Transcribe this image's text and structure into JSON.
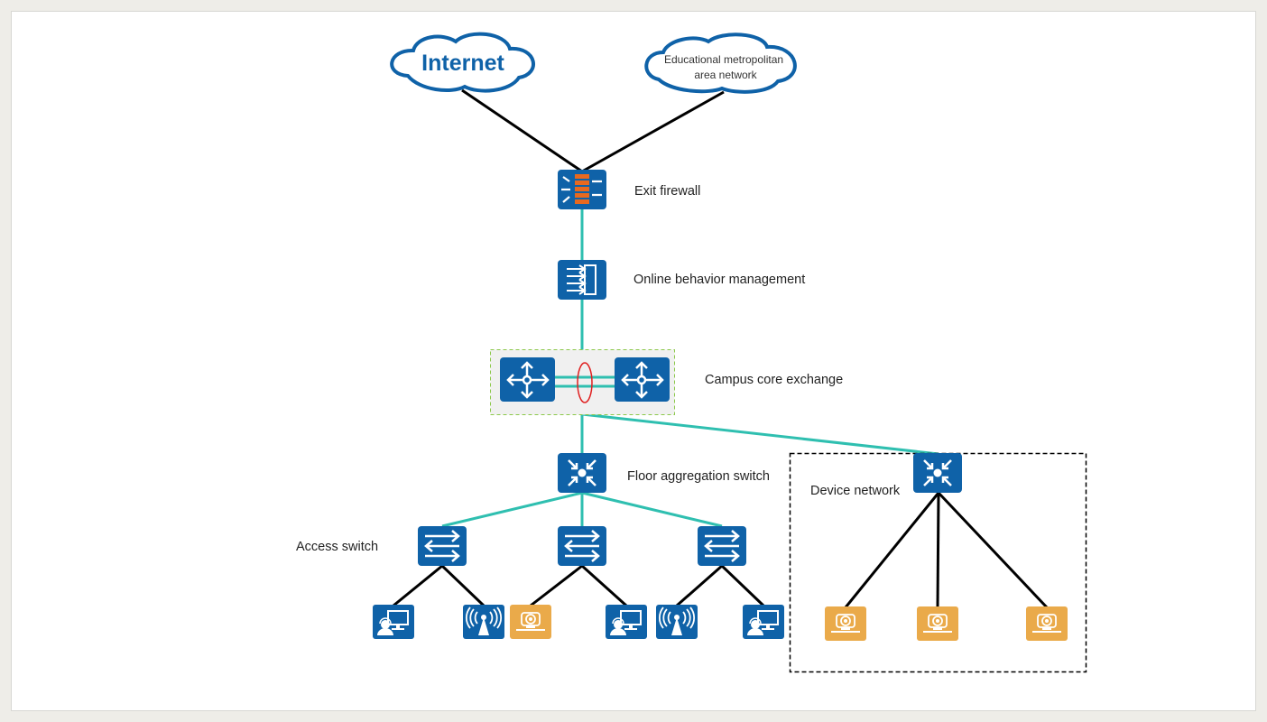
{
  "clouds": {
    "internet": "Internet",
    "education_line1": "Educational metropolitan",
    "education_line2": "area network"
  },
  "labels": {
    "exit_firewall": "Exit firewall",
    "online_behavior": "Online behavior management",
    "core": "Campus core exchange",
    "floor_aggregation": "Floor aggregation switch",
    "access_switch": "Access switch",
    "device_network": "Device network"
  },
  "colors": {
    "device_blue": "#0f62a8",
    "camera_orange": "#eaaa4a",
    "firewall_brick": "#e8691f",
    "trunk_teal": "#2fbfb0",
    "link_black": "#000000",
    "lag_red": "#e02020",
    "core_group_border": "#8cc84b"
  },
  "access_devices": [
    "pc-user-icon",
    "wifi-ap-icon",
    "camera-icon",
    "pc-user-icon",
    "wifi-ap-icon",
    "pc-user-icon"
  ],
  "device_network_devices": [
    "camera-icon",
    "camera-icon",
    "camera-icon"
  ]
}
